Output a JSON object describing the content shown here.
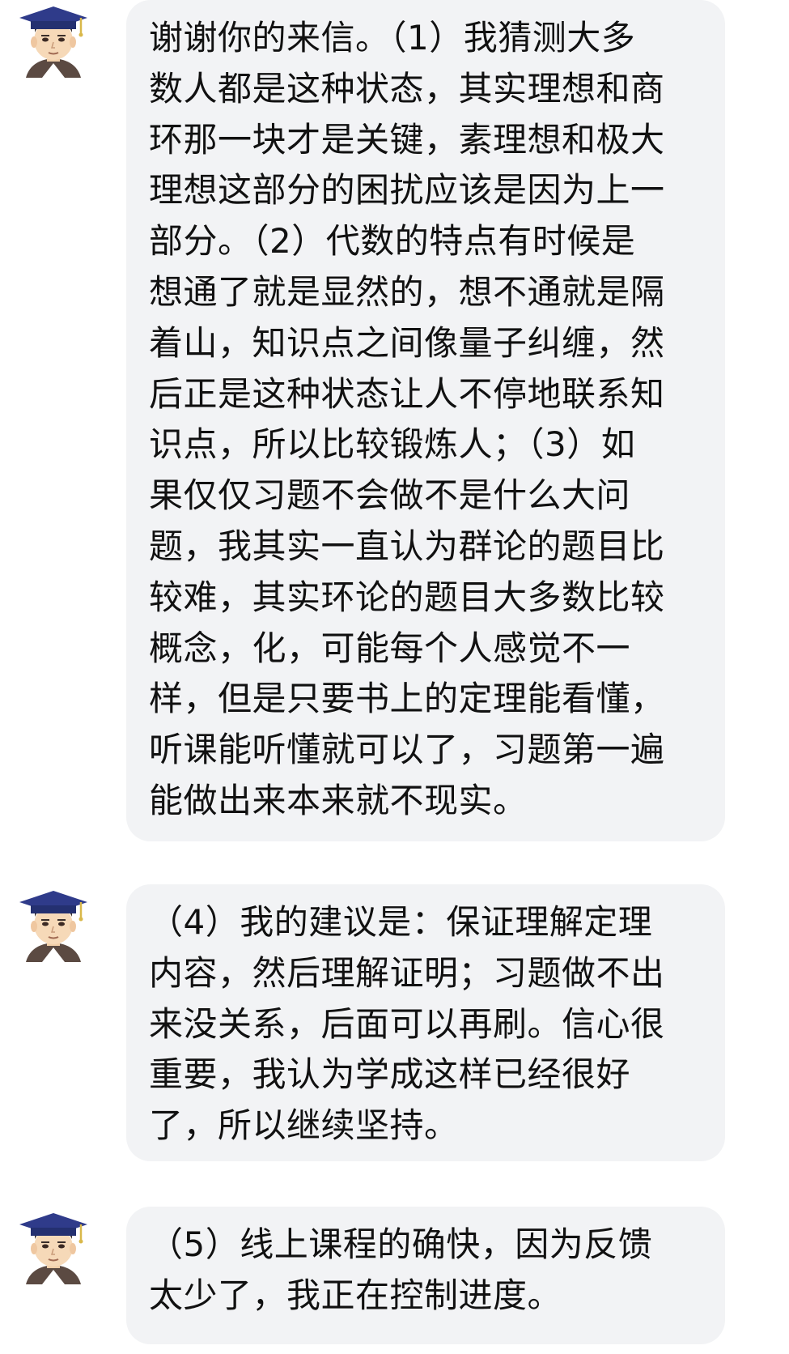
{
  "messages": [
    {
      "lines": [
        "谢谢你的来信。（1）我猜测大多",
        "数人都是这种状态，其实理想和商",
        "环那一块才是关键，素理想和极大",
        "理想这部分的困扰应该是因为上一",
        "部分。（2）代数的特点有时候是",
        "想通了就是显然的，想不通就是隔",
        "着山，知识点之间像量子纠缠，然",
        "后正是这种状态让人不停地联系知",
        "识点，所以比较锻炼人；（3）如",
        "果仅仅习题不会做不是什么大问",
        "题，我其实一直认为群论的题目比",
        "较难，其实环论的题目大多数比较",
        "概念，化，可能每个人感觉不一",
        "样，但是只要书上的定理能看懂，",
        "听课能听懂就可以了，习题第一遍",
        "能做出来本来就不现实。"
      ]
    },
    {
      "lines": [
        "（4）我的建议是：保证理解定理",
        "内容，然后理解证明；习题做不出",
        "来没关系，后面可以再刷。信心很",
        "重要，我认为学成这样已经很好",
        "了，所以继续坚持。"
      ]
    },
    {
      "lines": [
        "（5）线上课程的确快，因为反馈",
        "太少了，我正在控制进度。"
      ]
    }
  ],
  "colors": {
    "bubble_bg": "#f2f3f5",
    "text": "#111111",
    "cap": "#2f3b8a",
    "skin": "#f6d9b8"
  }
}
